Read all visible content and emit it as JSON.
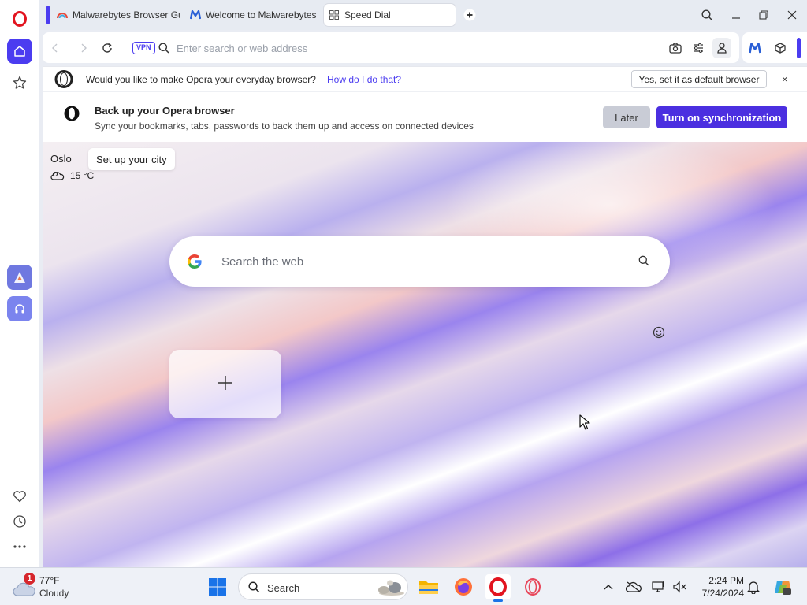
{
  "tabs": [
    {
      "title": "Malwarebytes Browser Gu",
      "icon": "rainbow-icon",
      "active": false
    },
    {
      "title": "Welcome to Malwarebytes",
      "icon": "malwarebytes-icon",
      "active": false
    },
    {
      "title": "Speed Dial",
      "icon": "speed-dial-grid-icon",
      "active": true
    }
  ],
  "addressbar": {
    "vpn_label": "VPN",
    "placeholder": "Enter search or web address",
    "value": ""
  },
  "default_bar": {
    "message": "Would you like to make Opera your everyday browser?",
    "link": "How do I do that?",
    "button": "Yes, set it as default browser",
    "close": "×"
  },
  "sync_bar": {
    "title": "Back up your Opera browser",
    "subtitle": "Sync your bookmarks, tabs, passwords to back them up and access on connected devices",
    "later": "Later",
    "turn_on": "Turn on synchronization"
  },
  "weather_widget": {
    "city": "Oslo",
    "tooltip": "Set up your city",
    "temperature": "15 °C"
  },
  "search": {
    "placeholder": "Search the web",
    "value": ""
  },
  "taskbar": {
    "weather_temp": "77°F",
    "weather_cond": "Cloudy",
    "weather_badge": "1",
    "search_label": "Search",
    "time": "2:24 PM",
    "date": "7/24/2024"
  },
  "colors": {
    "accent": "#4b3cf0",
    "opera_red": "#e2141f",
    "sync_button": "#4b2fe0"
  }
}
